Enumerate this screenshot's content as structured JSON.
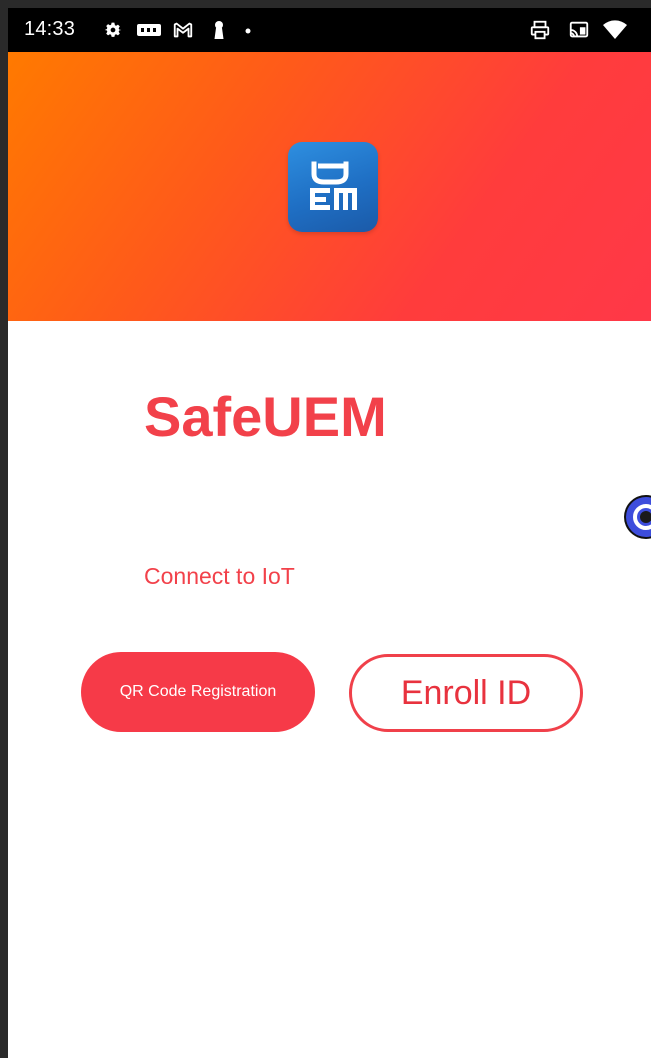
{
  "status_bar": {
    "time": "14:33",
    "left_icons": [
      "gear-icon",
      "fik-badge-icon",
      "gmail-icon",
      "keyhole-icon",
      "dot-icon"
    ],
    "right_icons": [
      "printer-icon",
      "cast-icon",
      "wifi-icon"
    ]
  },
  "header": {
    "logo_icon": "uem-logo-icon",
    "gradient_colors": [
      "#ff7a00",
      "#ff3848"
    ]
  },
  "main": {
    "title": "SafeUEM",
    "subtitle": "Connect to IoT",
    "qr_button_label": "QR Code Registration",
    "enroll_button_label": "Enroll ID"
  },
  "floating": {
    "icon": "floating-assistant-icon"
  },
  "colors": {
    "accent": "#f2414a",
    "button_fill": "#f63a48",
    "logo_blue": "#1f6fc4"
  }
}
